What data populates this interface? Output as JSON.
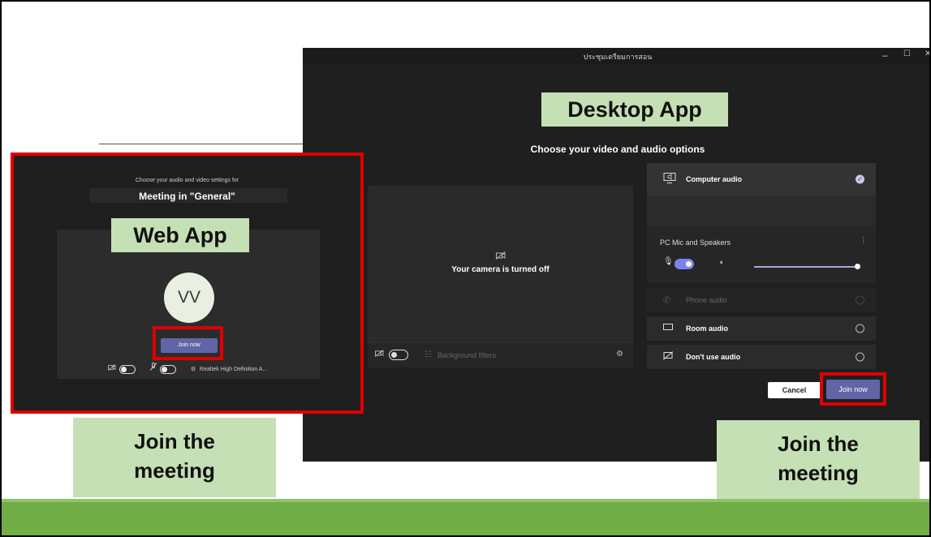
{
  "desktop": {
    "window_title": "ประชุมเตรียมการสอน",
    "window_controls": {
      "minimize": "–",
      "maximize": "☐",
      "close": "✕"
    },
    "heading": "Choose your video and audio options",
    "camera_off_text": "Your camera is turned off",
    "background_filters": "Background filters",
    "audio_options": {
      "computer_audio": "Computer audio",
      "device_name": "PC Mic and Speakers",
      "phone_audio": "Phone audio",
      "room_audio": "Room audio",
      "dont_use_audio": "Don't use audio"
    },
    "cancel_label": "Cancel",
    "join_label": "Join now"
  },
  "web": {
    "subtitle": "Choose your audio and video settings for",
    "meeting_title": "Meeting in \"General\"",
    "avatar_initials": "VV",
    "join_label": "Join now",
    "audio_device": "Realtek High Definition A..."
  },
  "labels": {
    "desktop_app": "Desktop App",
    "web_app": "Web App",
    "join_line1": "Join the",
    "join_line2": "meeting"
  },
  "colors": {
    "teams_purple": "#6264a7",
    "highlight_red": "#e00000",
    "label_green": "#c5e0b4",
    "footer_green": "#70ad47"
  }
}
